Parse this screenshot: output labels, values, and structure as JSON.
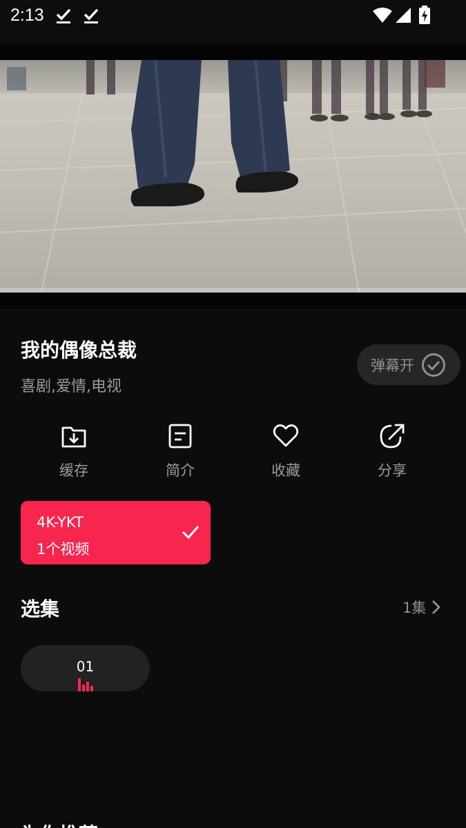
{
  "status_bar": {
    "time": "2:13",
    "icons": [
      "download-done-icon",
      "download-done-icon",
      "wifi-icon",
      "signal-icon",
      "battery-charging-icon"
    ]
  },
  "video": {
    "thumbnail": "walking-feet-on-tiled-floor"
  },
  "show": {
    "title": "我的偶像总裁",
    "tags": "喜剧,爱情,电视"
  },
  "danmaku": {
    "label": "弹幕开",
    "icon": "check-circle-icon"
  },
  "actions": [
    {
      "label": "缓存",
      "icon": "download-folder-icon"
    },
    {
      "label": "简介",
      "icon": "document-icon"
    },
    {
      "label": "收藏",
      "icon": "heart-icon"
    },
    {
      "label": "分享",
      "icon": "share-icon"
    }
  ],
  "source": {
    "name": "4K-YKT",
    "count": "1个视频",
    "selected": true
  },
  "episodes": {
    "section_title": "选集",
    "total": "1集",
    "items": [
      {
        "number": "01",
        "playing": true
      }
    ]
  },
  "recommend": {
    "title": "为你推荐"
  },
  "colors": {
    "accent": "#f8264e",
    "background": "#0c0c0c",
    "chip": "#222222",
    "muted_text": "#9b9b9b"
  }
}
